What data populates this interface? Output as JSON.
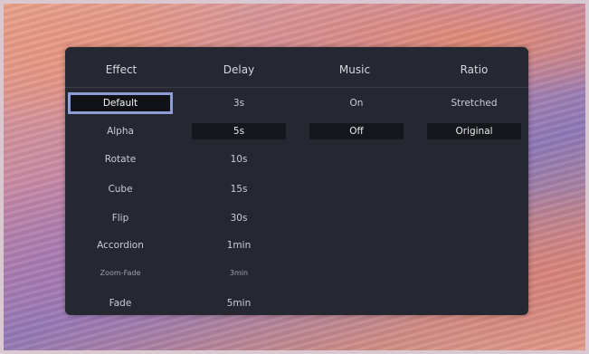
{
  "headers": {
    "effect": "Effect",
    "delay": "Delay",
    "music": "Music",
    "ratio": "Ratio"
  },
  "effect_options": [
    "Default",
    "Alpha",
    "Rotate",
    "Cube",
    "Flip",
    "Accordion",
    "Zoom-Fade",
    "Fade"
  ],
  "delay_options": [
    "3s",
    "5s",
    "10s",
    "15s",
    "30s",
    "1min",
    "3min",
    "5min"
  ],
  "music_options": [
    "On",
    "Off"
  ],
  "ratio_options": [
    "Stretched",
    "Original"
  ],
  "selected": {
    "effect": "Default",
    "delay": "5s",
    "music": "Off",
    "ratio": "Original"
  },
  "colors": {
    "panel_bg": "#252731",
    "focus_outline": "#8f9dd6",
    "selected_bg": "#16171c"
  }
}
